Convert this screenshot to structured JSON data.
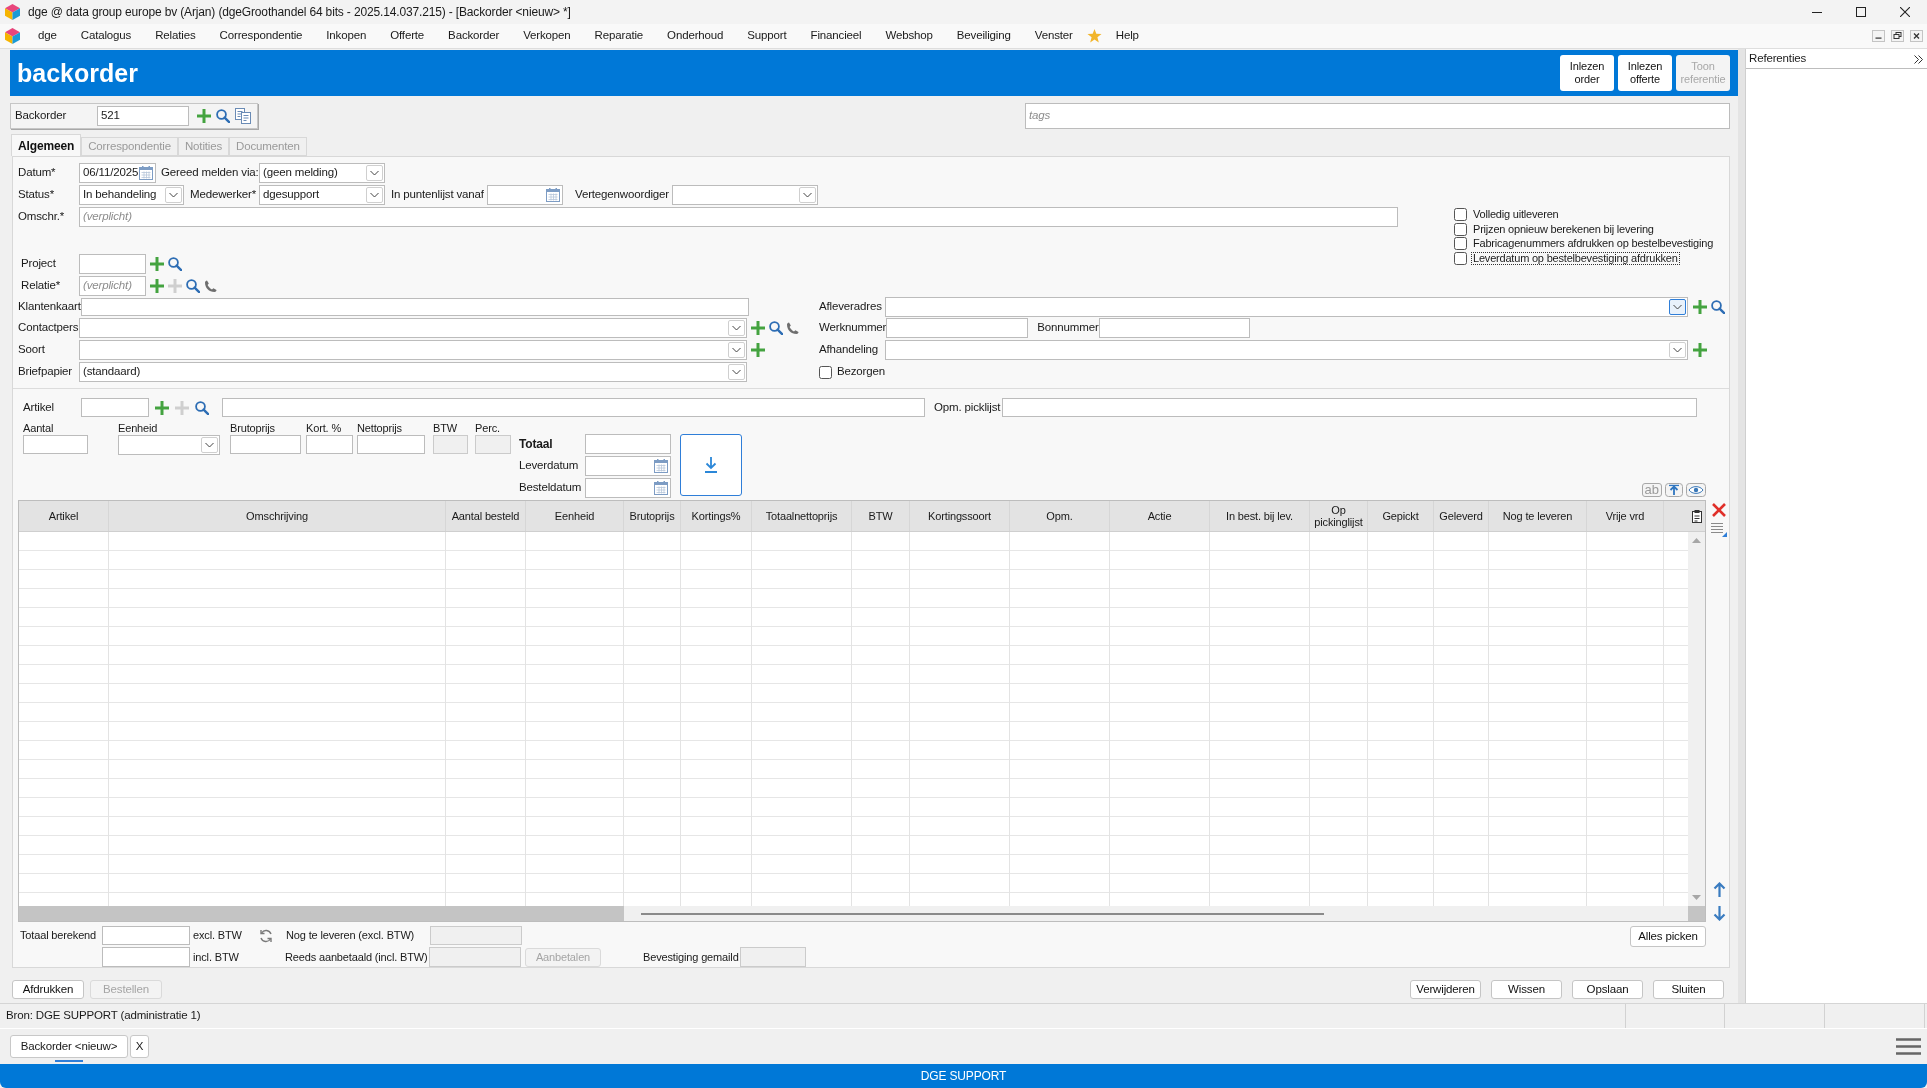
{
  "window": {
    "title": "dge @ data group europe bv (Arjan) (dgeGroothandel 64 bits - 2025.14.037.215) - [Backorder <nieuw> *]"
  },
  "menu": [
    {
      "kind": "item",
      "label": "dge"
    },
    {
      "kind": "item",
      "label": "Catalogus"
    },
    {
      "kind": "item",
      "label": "Relaties"
    },
    {
      "kind": "item",
      "label": "Correspondentie"
    },
    {
      "kind": "item",
      "label": "Inkopen"
    },
    {
      "kind": "item",
      "label": "Offerte"
    },
    {
      "kind": "item",
      "label": "Backorder"
    },
    {
      "kind": "item",
      "label": "Verkopen"
    },
    {
      "kind": "item",
      "label": "Reparatie"
    },
    {
      "kind": "item",
      "label": "Onderhoud"
    },
    {
      "kind": "item",
      "label": "Support"
    },
    {
      "kind": "item",
      "label": "Financieel"
    },
    {
      "kind": "item",
      "label": "Webshop"
    },
    {
      "kind": "item",
      "label": "Beveiliging"
    },
    {
      "kind": "item",
      "label": "Venster"
    },
    {
      "kind": "favorite"
    },
    {
      "kind": "item",
      "label": "Help"
    }
  ],
  "header": {
    "title": "backorder",
    "buttons": [
      {
        "label": "Inlezen order",
        "disabled": false
      },
      {
        "label": "Inlezen offerte",
        "disabled": false
      },
      {
        "label": "Toon referentie",
        "disabled": true
      }
    ]
  },
  "record": {
    "label": "Backorder",
    "value": "521"
  },
  "tags": {
    "placeholder": "tags"
  },
  "tabs": [
    {
      "label": "Algemeen",
      "selected": true,
      "disabled": false
    },
    {
      "label": "Correspondentie",
      "selected": false,
      "disabled": true
    },
    {
      "label": "Notities",
      "selected": false,
      "disabled": true
    },
    {
      "label": "Documenten",
      "selected": false,
      "disabled": true
    }
  ],
  "form": {
    "datum": {
      "label": "Datum*",
      "value": "06/11/2025"
    },
    "gereed_melden_via": {
      "label": "Gereed melden via:",
      "value": "(geen melding)"
    },
    "status": {
      "label": "Status*",
      "value": "In behandeling"
    },
    "medewerker": {
      "label": "Medewerker*",
      "value": "dgesupport"
    },
    "in_puntenlijst_vanaf": {
      "label": "In puntenlijst vanaf"
    },
    "vertegenwoordiger": {
      "label": "Vertegenwoordiger"
    },
    "omschrijving": {
      "label": "Omschr.*",
      "placeholder": "(verplicht)"
    },
    "options": [
      {
        "label": "Volledig uitleveren",
        "checked": false,
        "focused": false
      },
      {
        "label": "Prijzen opnieuw berekenen bij levering",
        "checked": false,
        "focused": false
      },
      {
        "label": "Fabricagenummers afdrukken op bestelbevestiging",
        "checked": false,
        "focused": false
      },
      {
        "label": "Leverdatum op bestelbevestiging afdrukken",
        "checked": false,
        "focused": true
      }
    ],
    "project": {
      "label": "Project"
    },
    "relatie": {
      "label": "Relatie*",
      "placeholder": "(verplicht)"
    },
    "klantenkaart": {
      "label": "Klantenkaart"
    },
    "contactpers": {
      "label": "Contactpers"
    },
    "soort": {
      "label": "Soort"
    },
    "briefpapier": {
      "label": "Briefpapier",
      "value": "(standaard)"
    },
    "afleveradres": {
      "label": "Afleveradres",
      "hovered": true
    },
    "werknummer": {
      "label": "Werknummer"
    },
    "bonnummer": {
      "label": "Bonnummer"
    },
    "afhandeling": {
      "label": "Afhandeling"
    },
    "bezorgen": {
      "label": "Bezorgen",
      "checked": false
    }
  },
  "article_entry": {
    "artikel": {
      "label": "Artikel"
    },
    "opm_picklijst": {
      "label": "Opm. picklijst"
    },
    "fields": [
      {
        "label": "Aantal",
        "kind": "input"
      },
      {
        "label": "Eenheid",
        "kind": "select"
      },
      {
        "label": "Brutoprijs",
        "kind": "input"
      },
      {
        "label": "Kort. %",
        "kind": "input"
      },
      {
        "label": "Nettoprijs",
        "kind": "input"
      },
      {
        "label": "BTW",
        "kind": "readonly"
      },
      {
        "label": "Perc.",
        "kind": "readonly"
      }
    ],
    "totaal": {
      "label": "Totaal"
    },
    "leverdatum": {
      "label": "Leverdatum"
    },
    "besteldatum": {
      "label": "Besteldatum"
    }
  },
  "table_tools": {
    "format_label": "ab"
  },
  "table": {
    "columns": [
      "Artikel",
      "Omschrijving",
      "Aantal besteld",
      "Eenheid",
      "Brutoprijs",
      "Kortings%",
      "Totaalnettoprijs",
      "BTW",
      "Kortingssoort",
      "Opm.",
      "Actie",
      "In best. bij lev.",
      "Op pickinglijst",
      "Gepickt",
      "Geleverd",
      "Nog te leveren",
      "Vrije vrd"
    ]
  },
  "totals": {
    "total_label": "Totaal berekend",
    "excl_label": "excl. BTW",
    "incl_label": "incl. BTW",
    "remaining_label": "Nog te leveren (excl. BTW)",
    "prepaid_label": "Reeds aanbetaald (incl. BTW)",
    "prepay_button": {
      "label": "Aanbetalen",
      "disabled": true
    },
    "confirmation_label": "Bevestiging gemaild",
    "pick_all_button": {
      "label": "Alles picken",
      "disabled": false
    }
  },
  "footer": {
    "actions_left": [
      {
        "label": "Afdrukken",
        "disabled": false
      },
      {
        "label": "Bestellen",
        "disabled": true
      }
    ],
    "actions_right": [
      {
        "label": "Verwijderen",
        "disabled": false
      },
      {
        "label": "Wissen",
        "disabled": false
      },
      {
        "label": "Opslaan",
        "disabled": false
      },
      {
        "label": "Sluiten",
        "disabled": false
      }
    ]
  },
  "status_bar": {
    "text": "Bron: DGE SUPPORT (administratie 1)"
  },
  "document_tabs": [
    {
      "label": "Backorder <nieuw>",
      "selected": true,
      "close": "X"
    }
  ],
  "bottom_bar": {
    "text": "DGE SUPPORT"
  },
  "references": {
    "title": "Referenties"
  }
}
